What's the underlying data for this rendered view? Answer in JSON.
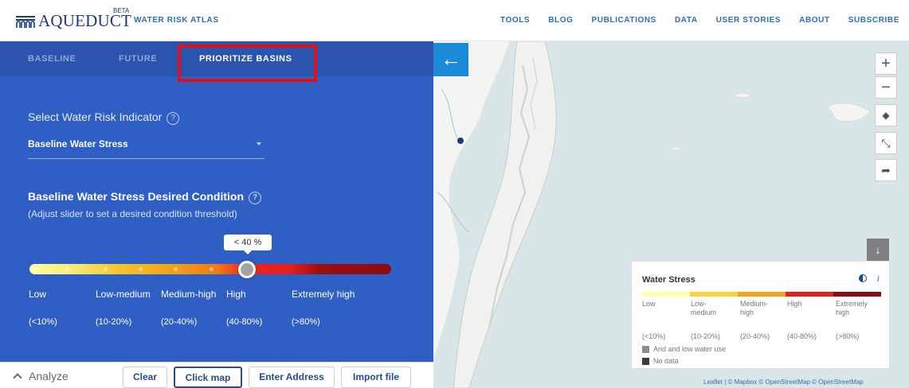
{
  "header": {
    "logo_text": "AQUEDUCT",
    "logo_badge": "BETA",
    "app_title": "WATER RISK ATLAS",
    "nav": [
      "TOOLS",
      "BLOG",
      "PUBLICATIONS",
      "DATA",
      "USER STORIES",
      "ABOUT",
      "SUBSCRIBE"
    ]
  },
  "tabs": {
    "baseline": "BASELINE",
    "future": "FUTURE",
    "prioritize": "PRIORITIZE BASINS"
  },
  "indicator": {
    "label": "Select Water Risk Indicator",
    "help": "?",
    "selected": "Baseline Water Stress"
  },
  "condition": {
    "title": "Baseline Water Stress Desired Condition",
    "help": "?",
    "subtitle": "(Adjust slider to set a desired condition threshold)",
    "slider_value": "< 40 %",
    "slider_level": 0.61
  },
  "levels": [
    {
      "label": "Low",
      "range": "(<10%)"
    },
    {
      "label": "Low-medium",
      "range": "(10-20%)"
    },
    {
      "label": "Medium-high",
      "range": "(20-40%)"
    },
    {
      "label": "High",
      "range": "(40-80%)"
    },
    {
      "label": "Extremely high",
      "range": "(>80%)"
    }
  ],
  "bottom": {
    "analyze": "Analyze",
    "clear": "Clear",
    "click_map": "Click map",
    "enter_address": "Enter Address",
    "import_file": "Import file"
  },
  "map": {
    "back": "←",
    "zoom_in": "+",
    "zoom_out": "−",
    "download": "↓",
    "attribution": "Leaflet | © Mapbox © OpenStreetMap © OpenStreetMap",
    "colors": {
      "land": "#f4f4f2",
      "water": "#d9e6e8",
      "accent": "#1b8ad8"
    }
  },
  "legend": {
    "title": "Water Stress",
    "info": "i",
    "labels": [
      {
        "label": "Low",
        "range": "(<10%)"
      },
      {
        "label": "Low-medium",
        "range": "(10-20%)"
      },
      {
        "label": "Medium-high",
        "range": "(20-40%)"
      },
      {
        "label": "High",
        "range": "(40-80%)"
      },
      {
        "label": "Extremely high",
        "range": "(>80%)"
      }
    ],
    "arid": "Arid and low water use",
    "no_data": "No data"
  }
}
